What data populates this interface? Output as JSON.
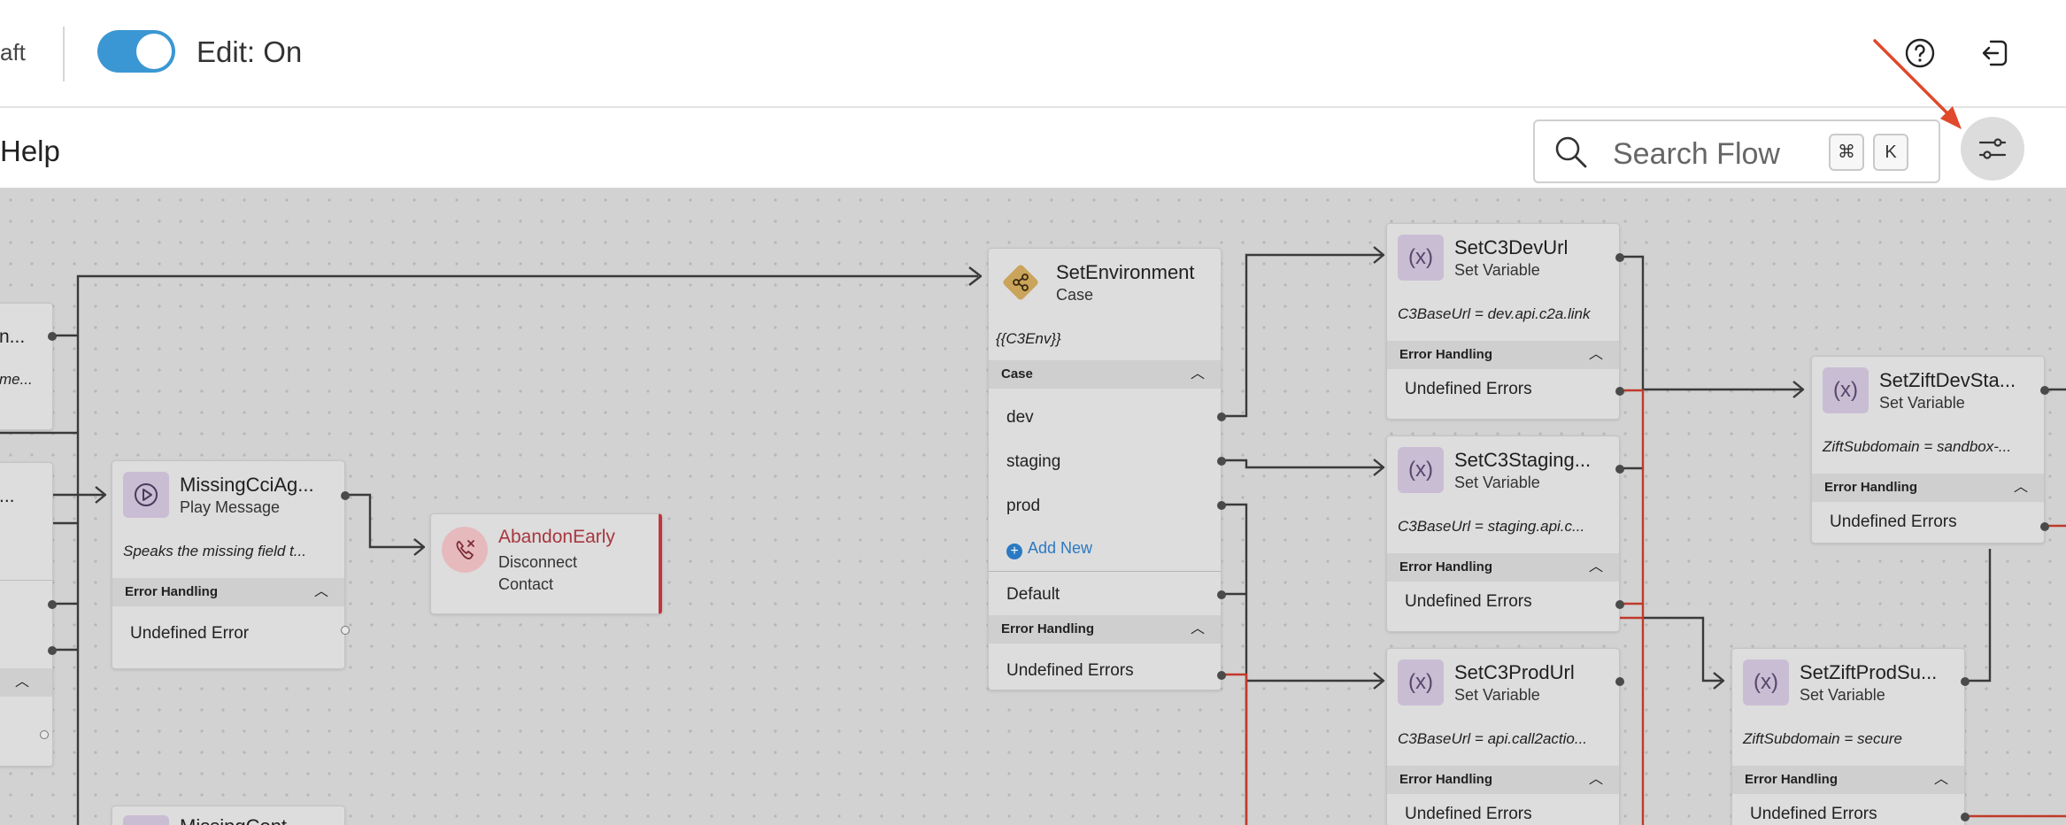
{
  "header": {
    "draft_fragment": "aft",
    "edit_toggle": {
      "state": "on",
      "color": "#3b97d3"
    },
    "edit_label": "Edit: On",
    "help_icon": "help-circle-icon",
    "exit_icon": "exit-icon"
  },
  "subheader": {
    "help_fragment": "Help",
    "search": {
      "placeholder": "Search Flow",
      "shortcut_cmd": "⌘",
      "shortcut_key": "K"
    },
    "settings_icon": "sliders-icon"
  },
  "canvas": {
    "left_partial_nodes": {
      "text1": "n...",
      "text2": "me...",
      "text3": "..."
    },
    "missing_cci": {
      "title": "MissingCciAg...",
      "type": "Play Message",
      "description": "Speaks the missing field t...",
      "error_header": "Error Handling",
      "error_row": "Undefined Error"
    },
    "abandon": {
      "title": "AbandonEarly",
      "type_line1": "Disconnect",
      "type_line2": "Contact",
      "accent_color": "#c1363f"
    },
    "bottom_partial": {
      "title": "MissingCont..."
    },
    "set_environment": {
      "title": "SetEnvironment",
      "type": "Case",
      "expression": "{{C3Env}}",
      "case_header": "Case",
      "cases": [
        "dev",
        "staging",
        "prod"
      ],
      "add_new": "Add New",
      "default_label": "Default",
      "error_header": "Error Handling",
      "error_row": "Undefined Errors"
    },
    "set_c3_dev": {
      "title": "SetC3DevUrl",
      "type": "Set Variable",
      "expression": "C3BaseUrl = dev.api.c2a.link",
      "error_header": "Error Handling",
      "error_row": "Undefined Errors"
    },
    "set_c3_staging": {
      "title": "SetC3Staging...",
      "type": "Set Variable",
      "expression": "C3BaseUrl = staging.api.c...",
      "error_header": "Error Handling",
      "error_row": "Undefined Errors"
    },
    "set_c3_prod": {
      "title": "SetC3ProdUrl",
      "type": "Set Variable",
      "expression": "C3BaseUrl = api.call2actio...",
      "error_header": "Error Handling",
      "error_row": "Undefined Errors"
    },
    "set_zift_dev": {
      "title": "SetZiftDevSta...",
      "type": "Set Variable",
      "expression": "ZiftSubdomain = sandbox-...",
      "error_header": "Error Handling",
      "error_row": "Undefined Errors"
    },
    "set_zift_prod": {
      "title": "SetZiftProdSu...",
      "type": "Set Variable",
      "expression": "ZiftSubdomain = secure",
      "error_header": "Error Handling",
      "error_row": "Undefined Errors"
    },
    "variable_icon_glyph": "(x)",
    "error_wire_color": "#c0392b",
    "annotation_arrow_color": "#e0492b"
  }
}
